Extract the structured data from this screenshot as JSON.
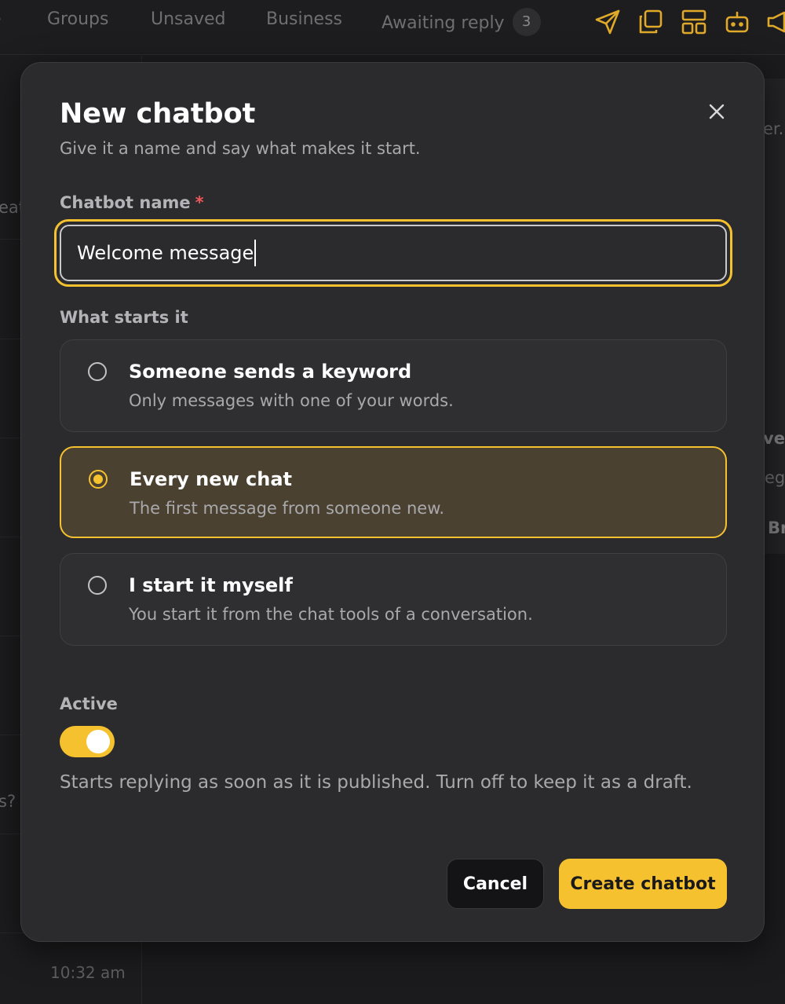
{
  "tabs": [
    {
      "label": "Groups"
    },
    {
      "label": "Unsaved"
    },
    {
      "label": "Business"
    },
    {
      "label": "Awaiting reply",
      "badge": "3"
    }
  ],
  "top_icons": [
    "send-icon",
    "copy-icon",
    "layout-icon",
    "bot-icon",
    "megaphone-icon"
  ],
  "background": {
    "snippets": [
      "er.",
      "eat",
      "vet",
      "eg",
      "Br",
      "s?"
    ],
    "time": "10:32 am"
  },
  "modal": {
    "title": "New chatbot",
    "subtitle": "Give it a name and say what makes it start.",
    "name_label": "Chatbot name",
    "required_mark": "*",
    "name_value": "Welcome message",
    "trigger_label": "What starts it",
    "options": [
      {
        "title": "Someone sends a keyword",
        "desc": "Only messages with one of your words.",
        "selected": false
      },
      {
        "title": "Every new chat",
        "desc": "The first message from someone new.",
        "selected": true
      },
      {
        "title": "I start it myself",
        "desc": "You start it from the chat tools of a conversation.",
        "selected": false
      }
    ],
    "active_label": "Active",
    "active_on": true,
    "active_help": "Starts replying as soon as it is published. Turn off to keep it as a draft.",
    "cancel_label": "Cancel",
    "create_label": "Create chatbot"
  },
  "colors": {
    "accent": "#f6c12f",
    "modal_bg": "#2b2b2e",
    "selected_bg": "#4a4130",
    "required": "#f0575b"
  }
}
